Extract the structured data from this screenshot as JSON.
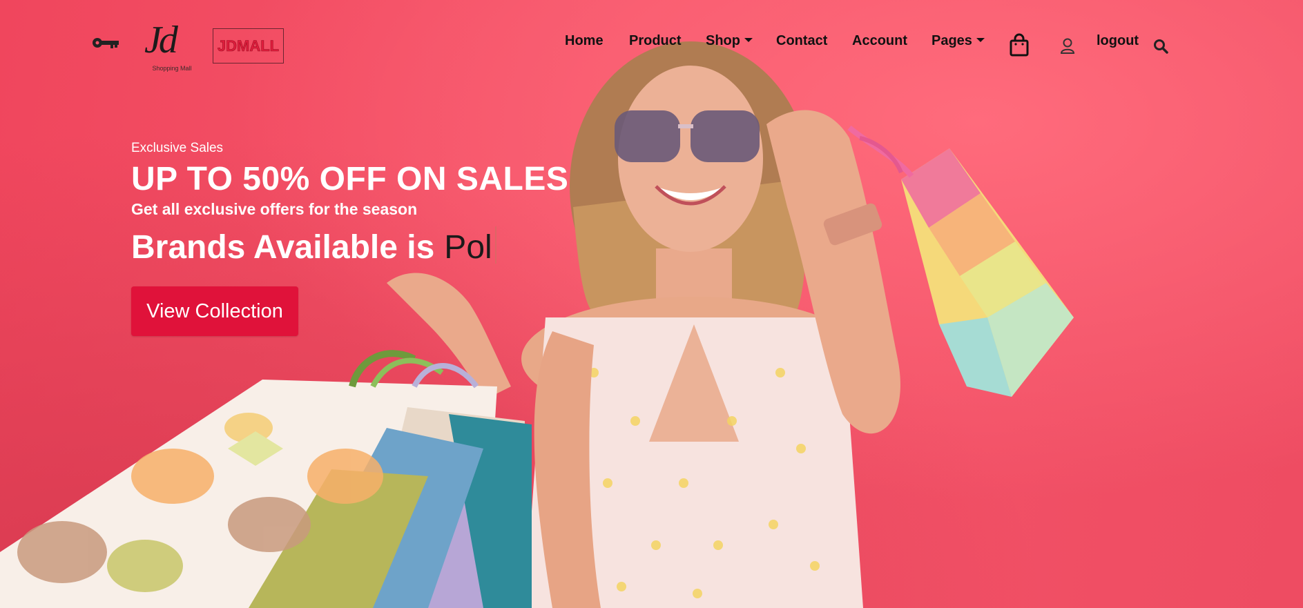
{
  "brand": {
    "logo_script": "Jd",
    "logo_subtitle": "Shopping Mall",
    "wordmark": "JDMALL"
  },
  "nav": {
    "links": [
      {
        "label": "Home"
      },
      {
        "label": "Product"
      },
      {
        "label": "Shop"
      },
      {
        "label": "Contact"
      },
      {
        "label": "Account"
      },
      {
        "label": "Pages"
      }
    ],
    "logout_label": "logout",
    "icons": [
      "key-icon",
      "shopping-bag-icon",
      "user-icon",
      "search-icon"
    ]
  },
  "hero": {
    "eyebrow": "Exclusive Sales",
    "headline": "UP TO 50% OFF ON SALES",
    "subhead": "Get all exclusive offers for the season",
    "brands_prefix": "Brands Available is",
    "brands_typed": "Pol",
    "cta_label": "View Collection"
  },
  "colors": {
    "background": "#f4546a",
    "cta": "#e0123a",
    "wordmark": "#e01d3d",
    "nav_text": "#111111"
  }
}
